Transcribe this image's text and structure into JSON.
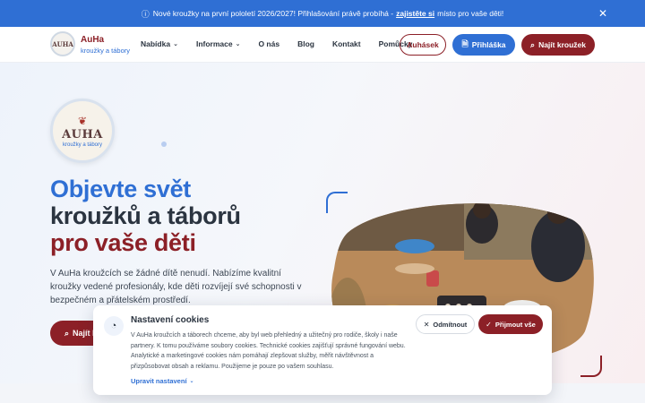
{
  "announcement": {
    "icon": "info-icon",
    "text_before": "Nové kroužky na první pololetí 2026/2027! Přihlašování právě probíhá -",
    "link": "zajistěte si",
    "text_after": "místo pro vaše děti!",
    "close_icon": "close-icon"
  },
  "header": {
    "brand_name": "AuHa",
    "brand_sub": "kroužky a tábory",
    "logo_text": "AUHA",
    "nav": [
      {
        "label": "Nabídka",
        "has_dropdown": true
      },
      {
        "label": "Informace",
        "has_dropdown": true
      },
      {
        "label": "O nás",
        "has_dropdown": false
      },
      {
        "label": "Blog",
        "has_dropdown": false
      },
      {
        "label": "Kontakt",
        "has_dropdown": false
      },
      {
        "label": "Pomůcky",
        "has_dropdown": false
      }
    ],
    "auhasek_label": "Auhásek",
    "prihlaska_label": "Přihláška",
    "najit_label": "Najít kroužek"
  },
  "hero": {
    "logo_big": "AUHA",
    "logo_small": "kroužky a tábory",
    "title_line1": "Objevte svět",
    "title_line2": "kroužků a táborů",
    "title_line3": "pro vaše děti",
    "lead": "V AuHa kroužcích se žádné dítě nenudí. Nabízíme kvalitní kroužky vedené profesionály, kde děti rozvíjejí své schopnosti v bezpečném a přátelském prostředí.",
    "cta_label": "Najít kroužek"
  },
  "cookie": {
    "title": "Nastavení cookies",
    "text": "V AuHa kroužcích a táborech chceme, aby byl web přehledný a užitečný pro rodiče, školy i naše partnery. K tomu používáme soubory cookies. Technické cookies zajišťují správné fungování webu. Analytické a marketingové cookies nám pomáhají zlepšovat služby, měřit návštěvnost a přizpůsobovat obsah a reklamu. Použijeme je pouze po vašem souhlasu.",
    "settings_link": "Upravit nastavení",
    "decline_label": "Odmítnout",
    "accept_label": "Přijmout vše"
  },
  "colors": {
    "primary_blue": "#2f6fd4",
    "brand_red": "#8c2027",
    "text_dark": "#2b3440"
  }
}
